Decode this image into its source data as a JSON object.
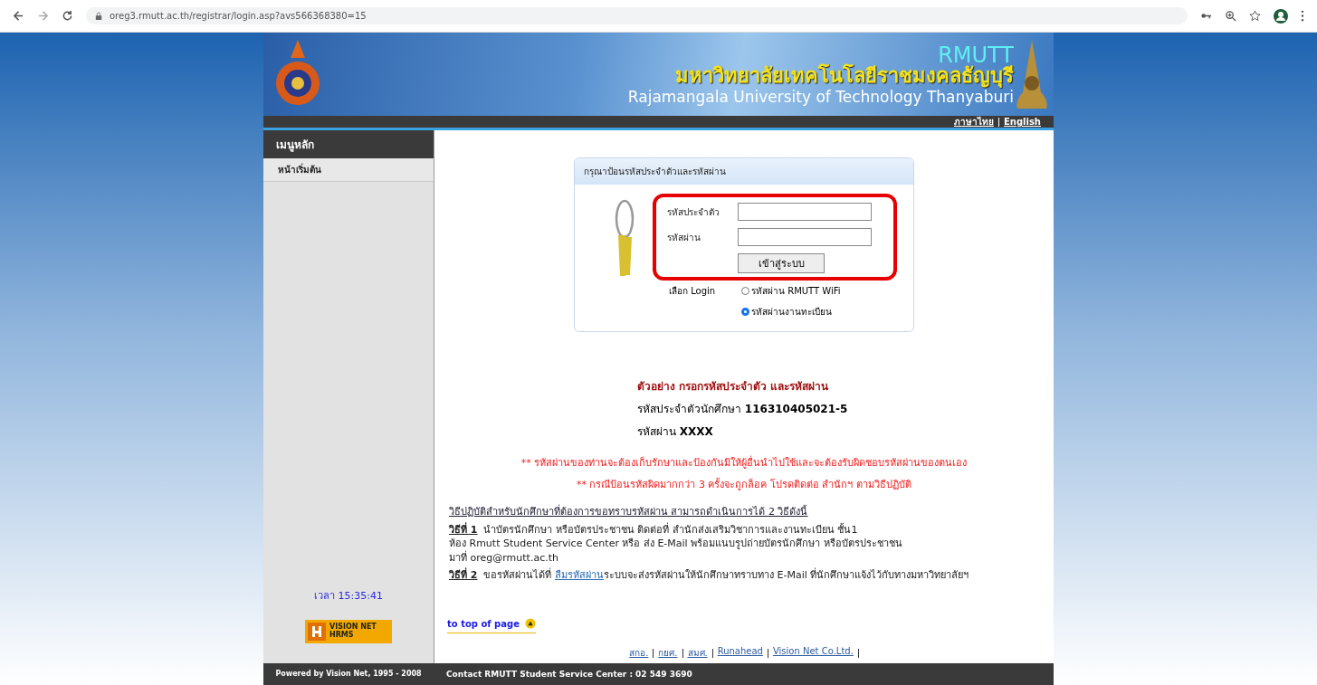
{
  "browser": {
    "url": "oreg3.rmutt.ac.th/registrar/login.asp?avs566368380=15"
  },
  "header": {
    "abbr": "RMUTT",
    "title_th": "มหาวิทยาลัยเทคโนโลยีราชมงคลธัญบุรี",
    "title_en": "Rajamangala University  of Technology Thanyaburi",
    "languages": [
      "ภาษาไทย",
      "English"
    ]
  },
  "sidebar": {
    "heading": "เมนูหลัก",
    "items": [
      "หน้าเริ่มต้น"
    ],
    "clock": "เวลา 15:35:41",
    "logo_texts": [
      "VISION NET",
      "HRMS"
    ],
    "powered_by": "Powered by Vision Net, 1995 - 2008"
  },
  "login": {
    "title": "กรุณาป้อนรหัสประจำตัวและรหัสผ่าน",
    "fields": [
      {
        "label": "รหัสประจำตัว"
      },
      {
        "label": "รหัสผ่าน"
      }
    ],
    "button": "เข้าสู่ระบบ",
    "choice_label": "เลือก Login",
    "options": [
      {
        "label": "รหัสผ่าน RMUTT WiFi",
        "selected": false
      },
      {
        "label": "รหัสผ่านงานทะเบียน",
        "selected": true
      }
    ]
  },
  "example": {
    "heading": "ตัวอย่าง กรอกรหัสประจำตัว และรหัสผ่าน",
    "lines": [
      "รหัสประจำตัวนักศึกษา **116310405021-5**",
      "รหัสผ่าน **XXXX**"
    ]
  },
  "warnings": [
    "** รหัสผ่านของท่านจะต้องเก็บรักษาและป้องกันมิให้ผู้อื่นนำไปใช้และจะต้องรับผิดชอบรหัสผ่านของตนเอง",
    "** กรณีป้อนรหัสผิดมากกว่า 3 ครั้งจะถูกล็อค โปรดติดต่อ สำนักฯ ตามวิธีปฏิบัติ"
  ],
  "instructions": {
    "link": "วิธีปฏิบัติสำหรับนักศึกษาที่ต้องการขอทราบรหัสผ่าน สามารถดำเนินการได้ 2 วิธีดังนี้",
    "methods": [
      {
        "label": "วิธีที่ 1",
        "text": "นำบัตรนักศึกษา หรือบัตรประชาชน ติดต่อที่ สำนักส่งเสริมวิชาการและงานทะเบียน ชั้น1\nห้อง Rmutt Student Service Center หรือ ส่ง E-Mail พร้อมแนบรูปถ่ายบัตรนักศึกษา หรือบัตรประชาชน\nมาที่ oreg@rmutt.ac.th"
      },
      {
        "label": "วิธีที่ 2",
        "text": "ขอรหัสผ่านได้ที่",
        "link": "ลืมรหัสผ่าน",
        "after": "ระบบจะส่งรหัสผ่านให้นักศึกษาทราบทาง E-Mail ที่นักศึกษาแจ้งไว้กับทางมหาวิทยาลัยฯ"
      }
    ]
  },
  "top_link": "to top of page",
  "footer_links": [
    "สกอ.",
    "กยศ.",
    "สมศ.",
    "Runahead",
    "Vision Net Co.Ltd."
  ],
  "contact": "Contact RMUTT Student Service Center : 02 549 3690"
}
